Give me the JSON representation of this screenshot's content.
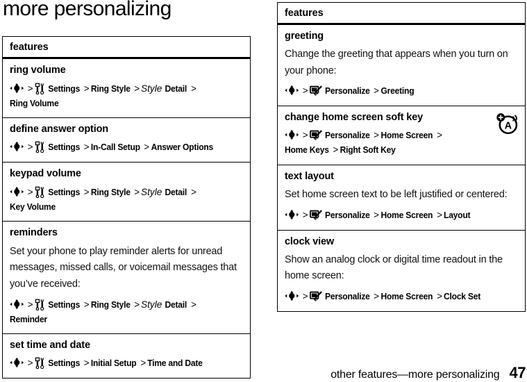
{
  "page": {
    "title": "more personalizing",
    "footer_text": "other features—more personalizing",
    "page_number": "47"
  },
  "icons": {
    "nav_key": "nav-key-icon",
    "settings": "settings-tools-icon",
    "personalize": "personalize-pencil-icon",
    "marker": "audio-note-marker-icon",
    "separator": ">"
  },
  "left_table": {
    "header": "features",
    "rows": [
      {
        "title": "ring volume",
        "desc": "",
        "path": [
          {
            "type": "icon",
            "icon": "nav-key-icon"
          },
          {
            "type": "sep",
            "text": ">"
          },
          {
            "type": "icon",
            "icon": "settings-tools-icon"
          },
          {
            "type": "label",
            "text": "Settings"
          },
          {
            "type": "sep",
            "text": ">"
          },
          {
            "type": "label",
            "text": "Ring Style"
          },
          {
            "type": "sep",
            "text": ">"
          },
          {
            "type": "italic",
            "text": "Style"
          },
          {
            "type": "label",
            "text": "Detail"
          },
          {
            "type": "sep",
            "text": ">"
          },
          {
            "type": "label",
            "text": "Ring Volume"
          }
        ]
      },
      {
        "title": "define answer option",
        "desc": "",
        "path": [
          {
            "type": "icon",
            "icon": "nav-key-icon"
          },
          {
            "type": "sep",
            "text": ">"
          },
          {
            "type": "icon",
            "icon": "settings-tools-icon"
          },
          {
            "type": "label",
            "text": "Settings"
          },
          {
            "type": "sep",
            "text": ">"
          },
          {
            "type": "label",
            "text": "In-Call Setup"
          },
          {
            "type": "sep",
            "text": ">"
          },
          {
            "type": "label",
            "text": "Answer Options"
          }
        ]
      },
      {
        "title": "keypad volume",
        "desc": "",
        "path": [
          {
            "type": "icon",
            "icon": "nav-key-icon"
          },
          {
            "type": "sep",
            "text": ">"
          },
          {
            "type": "icon",
            "icon": "settings-tools-icon"
          },
          {
            "type": "label",
            "text": "Settings"
          },
          {
            "type": "sep",
            "text": ">"
          },
          {
            "type": "label",
            "text": "Ring Style"
          },
          {
            "type": "sep",
            "text": ">"
          },
          {
            "type": "italic",
            "text": "Style"
          },
          {
            "type": "label",
            "text": "Detail"
          },
          {
            "type": "sep",
            "text": ">"
          },
          {
            "type": "label",
            "text": "Key Volume"
          }
        ]
      },
      {
        "title": "reminders",
        "desc": "Set your phone to play reminder alerts for unread messages, missed calls, or voicemail messages that you’ve received:",
        "path": [
          {
            "type": "icon",
            "icon": "nav-key-icon"
          },
          {
            "type": "sep",
            "text": ">"
          },
          {
            "type": "icon",
            "icon": "settings-tools-icon"
          },
          {
            "type": "label",
            "text": "Settings"
          },
          {
            "type": "sep",
            "text": ">"
          },
          {
            "type": "label",
            "text": "Ring Style"
          },
          {
            "type": "sep",
            "text": ">"
          },
          {
            "type": "italic",
            "text": "Style"
          },
          {
            "type": "label",
            "text": "Detail"
          },
          {
            "type": "sep",
            "text": ">"
          },
          {
            "type": "label",
            "text": "Reminder"
          }
        ]
      },
      {
        "title": "set time and date",
        "desc": "",
        "path": [
          {
            "type": "icon",
            "icon": "nav-key-icon"
          },
          {
            "type": "sep",
            "text": ">"
          },
          {
            "type": "icon",
            "icon": "settings-tools-icon"
          },
          {
            "type": "label",
            "text": "Settings"
          },
          {
            "type": "sep",
            "text": ">"
          },
          {
            "type": "label",
            "text": "Initial Setup"
          },
          {
            "type": "sep",
            "text": ">"
          },
          {
            "type": "label",
            "text": "Time and Date"
          }
        ]
      }
    ]
  },
  "right_table": {
    "header": "features",
    "rows": [
      {
        "title": "greeting",
        "desc": "Change the greeting that appears when you turn on your phone:",
        "marker": false,
        "path": [
          {
            "type": "icon",
            "icon": "nav-key-icon"
          },
          {
            "type": "sep",
            "text": ">"
          },
          {
            "type": "icon",
            "icon": "personalize-pencil-icon"
          },
          {
            "type": "label",
            "text": "Personalize"
          },
          {
            "type": "sep",
            "text": ">"
          },
          {
            "type": "label",
            "text": "Greeting"
          }
        ]
      },
      {
        "title": "change home screen soft key",
        "desc": "",
        "marker": true,
        "path": [
          {
            "type": "icon",
            "icon": "nav-key-icon"
          },
          {
            "type": "sep",
            "text": ">"
          },
          {
            "type": "icon",
            "icon": "personalize-pencil-icon"
          },
          {
            "type": "label",
            "text": "Personalize"
          },
          {
            "type": "sep",
            "text": ">"
          },
          {
            "type": "label",
            "text": "Home Screen"
          },
          {
            "type": "sep",
            "text": ">"
          },
          {
            "type": "label",
            "text": "Home Keys"
          },
          {
            "type": "sep",
            "text": ">"
          },
          {
            "type": "label",
            "text": "Right Soft Key"
          }
        ]
      },
      {
        "title": "text layout",
        "desc": "Set home screen text to be left justified or centered:",
        "marker": false,
        "path": [
          {
            "type": "icon",
            "icon": "nav-key-icon"
          },
          {
            "type": "sep",
            "text": ">"
          },
          {
            "type": "icon",
            "icon": "personalize-pencil-icon"
          },
          {
            "type": "label",
            "text": "Personalize"
          },
          {
            "type": "sep",
            "text": ">"
          },
          {
            "type": "label",
            "text": "Home Screen"
          },
          {
            "type": "sep",
            "text": ">"
          },
          {
            "type": "label",
            "text": "Layout"
          }
        ]
      },
      {
        "title": "clock view",
        "desc": "Show an analog clock or digital time readout in the home screen:",
        "marker": false,
        "path": [
          {
            "type": "icon",
            "icon": "nav-key-icon"
          },
          {
            "type": "sep",
            "text": ">"
          },
          {
            "type": "icon",
            "icon": "personalize-pencil-icon"
          },
          {
            "type": "label",
            "text": "Personalize"
          },
          {
            "type": "sep",
            "text": ">"
          },
          {
            "type": "label",
            "text": "Home Screen"
          },
          {
            "type": "sep",
            "text": ">"
          },
          {
            "type": "label",
            "text": "Clock Set"
          }
        ]
      }
    ]
  }
}
